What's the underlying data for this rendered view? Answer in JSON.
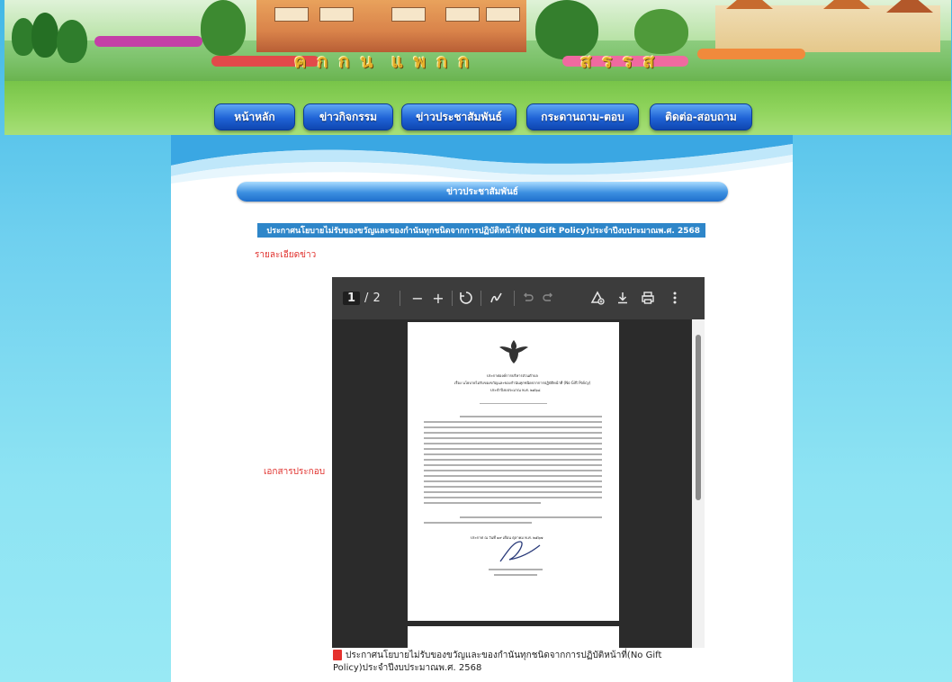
{
  "banner": {
    "title_art": "สุพรรณบุรี",
    "site_name_letters": [
      "ค",
      "ก",
      "ก",
      "น",
      "แ",
      "พ",
      "ก",
      "ก",
      "ส",
      "ร",
      "ร",
      "ส"
    ]
  },
  "nav": {
    "items": [
      {
        "label": "หน้าหลัก"
      },
      {
        "label": "ข่าวกิจกรรม"
      },
      {
        "label": "ข่าวประชาสัมพันธ์"
      },
      {
        "label": "กระดานถาม-ตอบ"
      },
      {
        "label": "ติดต่อ-สอบถาม"
      }
    ]
  },
  "section": {
    "heading": "ข่าวประชาสัมพันธ์"
  },
  "news": {
    "title": "ประกาศนโยบายไม่รับของขวัญและของกำนันทุกชนิดจากการปฏิบัติหน้าที่(No Gift Policy)ประจำปีงบประมาณพ.ศ. 2568",
    "detail_label": "รายละเอียดข่าว",
    "attachment_label": "เอกสารประกอบ",
    "file_name": "ประกาศนโยบายไม่รับของขวัญและของกำนันทุกชนิดจากการปฏิบัติหน้าที่(No Gift Policy)ประจำปีงบประมาณพ.ศ. 2568"
  },
  "pdf_viewer": {
    "current_page": "1",
    "page_separator": "/",
    "total_pages": "2",
    "zoom_out": "−",
    "zoom_in": "+",
    "icons": [
      "fit-page-icon",
      "draw-icon",
      "undo-icon",
      "redo-icon",
      "add-text-icon",
      "download-icon",
      "print-icon",
      "more-icon"
    ]
  },
  "document": {
    "heading1": "ประกาศองค์การบริหารส่วนตำบล",
    "heading2": "เรื่อง นโยบายไม่รับของขวัญและของกำนันทุกชนิดจากการปฏิบัติหน้าที่ (No Gift Policy)",
    "heading3": "ประจำปีงบประมาณ พ.ศ. ๒๕๖๘",
    "date_line": "ประกาศ ณ วันที่ ๑๙ เดือน ตุลาคม พ.ศ. ๒๕๖๗"
  },
  "colors": {
    "nav_button": "#1f63d6",
    "section_bar": "#3c8fe0",
    "title_bar": "#2e86c9",
    "label_red": "#e0302c",
    "background": "#8de3f3"
  }
}
